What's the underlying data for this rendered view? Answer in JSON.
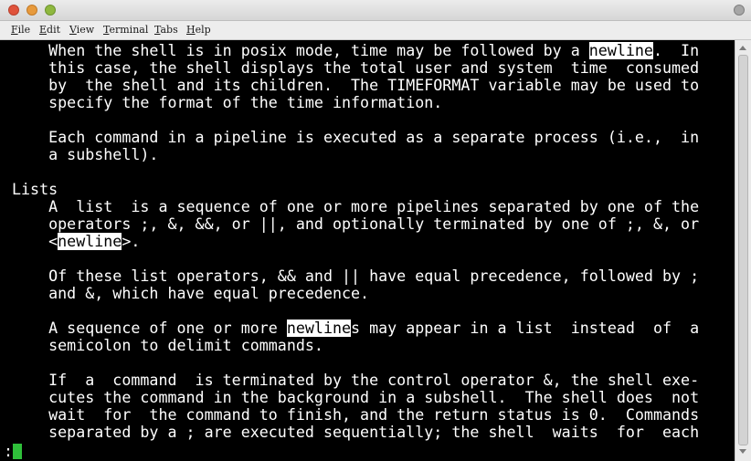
{
  "window": {
    "buttons": [
      "close",
      "minimize",
      "maximize",
      "restore"
    ],
    "colors": {
      "close": "#e0533b",
      "minimize": "#e79a3c",
      "maximize": "#8fb83f",
      "background": "#000000",
      "text": "#ffffff",
      "cursor": "#2fbf3a"
    }
  },
  "menubar": {
    "items": [
      {
        "u": "F",
        "rest": "ile"
      },
      {
        "u": "E",
        "rest": "dit"
      },
      {
        "u": "V",
        "rest": "iew"
      },
      {
        "u": "T",
        "rest": "erminal"
      },
      {
        "u": "T",
        "rest": "abs"
      },
      {
        "u": "H",
        "rest": "elp"
      }
    ]
  },
  "terminal": {
    "lines": [
      [
        {
          "t": "    When the shell is in posix mode, time may be followed by a "
        },
        {
          "t": "newline",
          "hl": true
        },
        {
          "t": ".  In"
        }
      ],
      [
        {
          "t": "    this case, the shell displays the total user and system  time  consumed"
        }
      ],
      [
        {
          "t": "    by  the shell and its children.  The TIMEFORMAT variable may be used to"
        }
      ],
      [
        {
          "t": "    specify the format of the time information."
        }
      ],
      [],
      [
        {
          "t": "    Each command in a pipeline is executed as a separate process (i.e.,  in"
        }
      ],
      [
        {
          "t": "    a subshell)."
        }
      ],
      [],
      [
        {
          "t": "Lists"
        }
      ],
      [
        {
          "t": "    A  list  is a sequence of one or more pipelines separated by one of the"
        }
      ],
      [
        {
          "t": "    operators ;, &, &&, or ||, and optionally terminated by one of ;, &, or"
        }
      ],
      [
        {
          "t": "    <"
        },
        {
          "t": "newline",
          "hl": true
        },
        {
          "t": ">."
        }
      ],
      [],
      [
        {
          "t": "    Of these list operators, && and || have equal precedence, followed by ;"
        }
      ],
      [
        {
          "t": "    and &, which have equal precedence."
        }
      ],
      [],
      [
        {
          "t": "    A sequence of one or more "
        },
        {
          "t": "newline",
          "hl": true
        },
        {
          "t": "s may appear in a list  instead  of  a"
        }
      ],
      [
        {
          "t": "    semicolon to delimit commands."
        }
      ],
      [],
      [
        {
          "t": "    If  a  command  is terminated by the control operator &, the shell exe-"
        }
      ],
      [
        {
          "t": "    cutes the command in the background in a subshell.  The shell does  not"
        }
      ],
      [
        {
          "t": "    wait  for  the command to finish, and the return status is 0.  Commands"
        }
      ],
      [
        {
          "t": "    separated by a ; are executed sequentially; the shell  waits  for  each"
        }
      ]
    ],
    "prompt": ":"
  }
}
